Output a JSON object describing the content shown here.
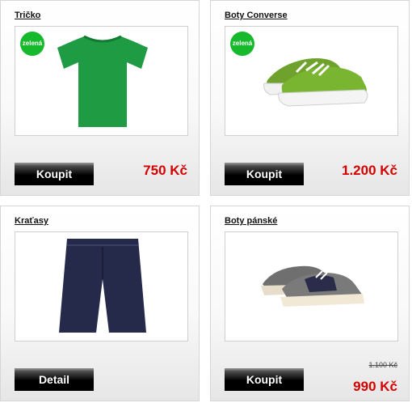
{
  "products": [
    {
      "title": "Tričko",
      "badge": "zelená",
      "button": "Koupit",
      "price": "750 Kč",
      "image": "green-tshirt"
    },
    {
      "title": "Boty Converse",
      "badge": "zelená",
      "button": "Koupit",
      "price": "1.200 Kč",
      "image": "green-sneakers"
    },
    {
      "title": "Kraťasy",
      "button": "Detail",
      "price": "",
      "image": "navy-shorts"
    },
    {
      "title": "Boty pánské",
      "button": "Koupit",
      "old_price": "1.100 Kč",
      "price": "990 Kč",
      "image": "grey-navy-shoes"
    }
  ],
  "colors": {
    "price": "#d40000",
    "badge": "#16b82c",
    "button": "#000000"
  }
}
